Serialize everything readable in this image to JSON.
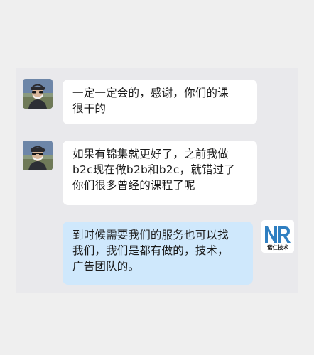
{
  "chat": {
    "messages": [
      {
        "direction": "incoming",
        "avatar_icon": "user-avatar-photo",
        "lines": [
          "一定一定会的，感谢，你们的课",
          "很干的"
        ]
      },
      {
        "direction": "incoming",
        "avatar_icon": "user-avatar-photo",
        "lines": [
          "如果有锦集就更好了，之前我做",
          "b2c现在做b2b和b2c，就错过了",
          "你们很多曾经的课程了呢"
        ]
      },
      {
        "direction": "outgoing",
        "avatar_icon": "company-logo",
        "lines": [
          "到时候需要我们的服务也可以找",
          "我们，我们是都有做的，技术，",
          "广告团队的。"
        ]
      }
    ],
    "logo_caption": "诺仁技术"
  },
  "colors": {
    "page_bg": "#efefef",
    "panel_bg": "#e9e9ec",
    "incoming_bubble": "#ffffff",
    "outgoing_bubble": "#cfe8fc",
    "logo_blue": "#2f7fc1"
  }
}
